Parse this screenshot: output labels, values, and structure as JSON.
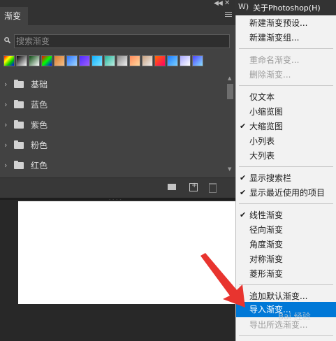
{
  "menubar": {
    "partial_item": "W)",
    "about": "关于Photoshop(H)"
  },
  "panel": {
    "tab": "渐变",
    "search_placeholder": "搜索渐变",
    "swatch_colors": [
      [
        "#ff0000",
        "#ffff00",
        "#00c800",
        "#0000ff"
      ],
      [
        "#000000",
        "#ffffff"
      ],
      [
        "#0a4a10",
        "#ffffff"
      ],
      [
        "#ff0000",
        "#00ff00",
        "#0000ff"
      ],
      [
        "#d97b2f",
        "#f3c08a"
      ],
      [
        "#2f76ff",
        "#9fd6ff"
      ],
      [
        "#4e2dff",
        "#9e5dff"
      ],
      [
        "#0fb0ff",
        "#7fe6ff"
      ],
      [
        "#27b39b",
        "#bdf0e4"
      ],
      [
        "#8a8a8a",
        "#f0f0f0"
      ],
      [
        "#ff8a5b",
        "#ffd89e"
      ],
      [
        "#c9a07e",
        "#eeeeee"
      ],
      [
        "#ff6a00",
        "#ff0066"
      ],
      [
        "#1c7bff",
        "#7ad0ff"
      ],
      [
        "#a8a8ff",
        "#ffffff"
      ],
      [
        "#4e44ff",
        "#88e0ff"
      ]
    ],
    "folders": [
      "基础",
      "蓝色",
      "紫色",
      "粉色",
      "红色"
    ]
  },
  "menu": {
    "items": [
      {
        "label": "新建渐变预设...",
        "enabled": true
      },
      {
        "label": "新建渐变组...",
        "enabled": true
      },
      {
        "label": "重命名渐变...",
        "enabled": false
      },
      {
        "label": "删除渐变...",
        "enabled": false
      },
      {
        "label": "仅文本",
        "enabled": true
      },
      {
        "label": "小缩览图",
        "enabled": true
      },
      {
        "label": "大缩览图",
        "enabled": true,
        "checked": true
      },
      {
        "label": "小列表",
        "enabled": true
      },
      {
        "label": "大列表",
        "enabled": true
      },
      {
        "label": "显示搜索栏",
        "enabled": true,
        "checked": true
      },
      {
        "label": "显示最近使用的项目",
        "enabled": true,
        "checked": true
      },
      {
        "label": "线性渐变",
        "enabled": true,
        "checked": true
      },
      {
        "label": "径向渐变",
        "enabled": true
      },
      {
        "label": "角度渐变",
        "enabled": true
      },
      {
        "label": "对称渐变",
        "enabled": true
      },
      {
        "label": "菱形渐变",
        "enabled": true
      },
      {
        "label": "追加默认渐变...",
        "enabled": true
      },
      {
        "label": "导入渐变...",
        "enabled": true,
        "highlighted": true
      },
      {
        "label": "导出所选渐变...",
        "enabled": false
      }
    ],
    "highlight_color": "#0078d7"
  },
  "annotation": {
    "arrow_color": "#e8342f"
  },
  "watermark": "Bai 经验"
}
